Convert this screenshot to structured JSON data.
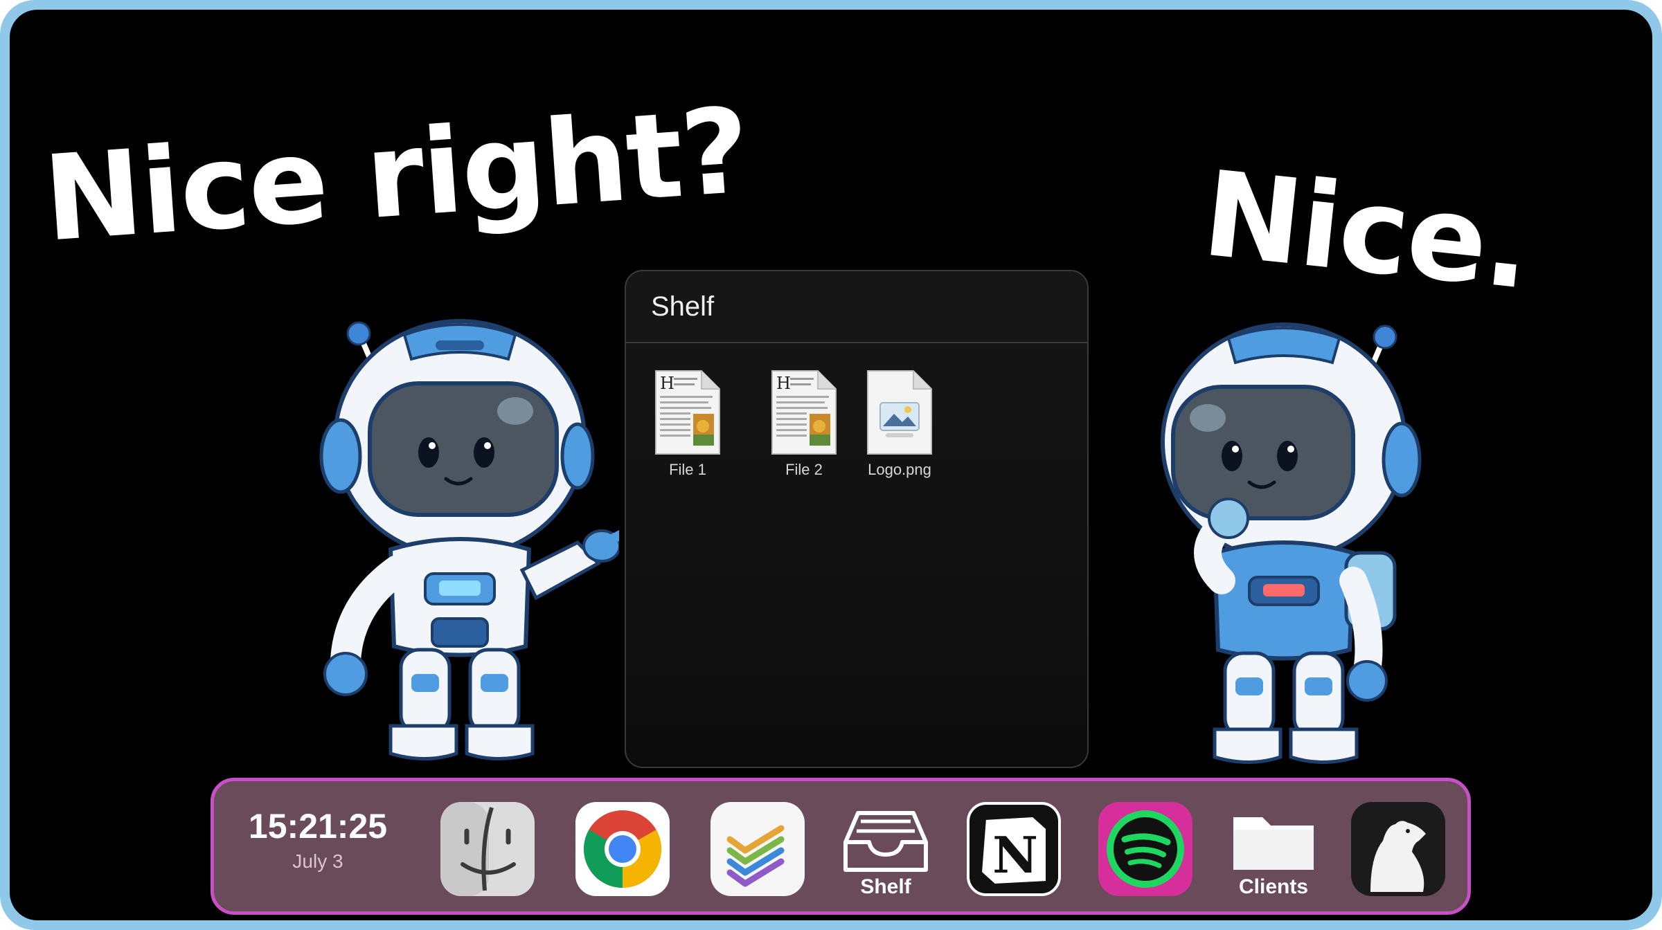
{
  "captions": {
    "left": "Nice right?",
    "right": "Nice."
  },
  "shelf": {
    "title": "Shelf",
    "files": [
      {
        "label": "File 1",
        "icon": "document-icon"
      },
      {
        "label": "File 2",
        "icon": "document-icon"
      },
      {
        "label": "Logo.png",
        "icon": "image-file-icon"
      }
    ]
  },
  "dock": {
    "clock": {
      "time": "15:21:25",
      "date": "July 3"
    },
    "apps": [
      {
        "name": "Finder",
        "icon": "finder-icon",
        "label": ""
      },
      {
        "name": "Chrome",
        "icon": "chrome-icon",
        "label": ""
      },
      {
        "name": "Tasks",
        "icon": "stacked-checks-icon",
        "label": ""
      },
      {
        "name": "Shelf",
        "icon": "inbox-tray-icon",
        "label": "Shelf"
      },
      {
        "name": "Notion",
        "icon": "notion-icon",
        "label": ""
      },
      {
        "name": "Spotify",
        "icon": "spotify-icon",
        "label": ""
      },
      {
        "name": "Clients",
        "icon": "folder-icon",
        "label": "Clients"
      },
      {
        "name": "Bear",
        "icon": "bear-icon",
        "label": ""
      }
    ]
  },
  "colors": {
    "frame": "#8fc8e8",
    "dock_background": "#6a4b5a",
    "dock_border": "#c84fc8",
    "spotify_green": "#1ed760",
    "spotify_pink": "#d62e9a"
  }
}
